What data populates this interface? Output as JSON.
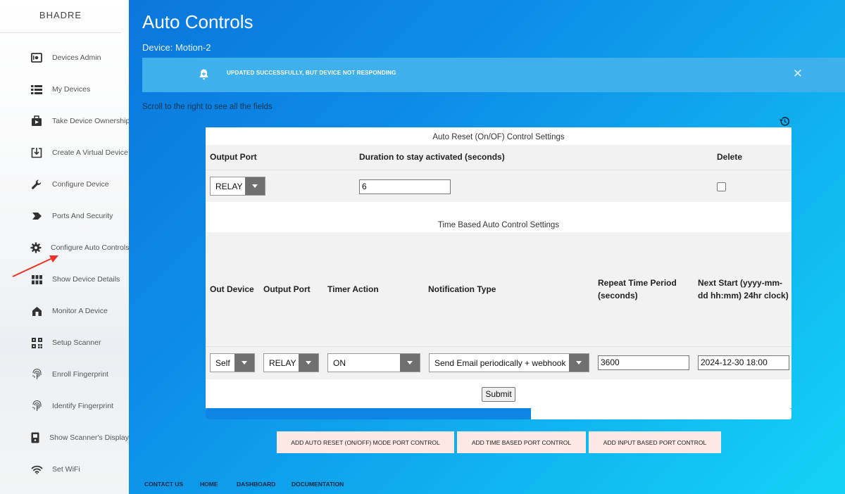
{
  "sidebar": {
    "brand": "BHADRE",
    "items": [
      {
        "label": "Devices Admin",
        "icon": "device-admin-icon"
      },
      {
        "label": "My Devices",
        "icon": "list-icon"
      },
      {
        "label": "Take Device Ownership",
        "icon": "ownership-icon"
      },
      {
        "label": "Create A Virtual Device",
        "icon": "download-box-icon"
      },
      {
        "label": "Configure Device",
        "icon": "wrench-icon"
      },
      {
        "label": "Ports And Security",
        "icon": "label-arrow-icon"
      },
      {
        "label": "Configure Auto Controls",
        "icon": "gear-icon"
      },
      {
        "label": "Show Device Details",
        "icon": "grid-icon"
      },
      {
        "label": "Monitor A Device",
        "icon": "home-icon"
      },
      {
        "label": "Setup Scanner",
        "icon": "qr-code-icon"
      },
      {
        "label": "Enroll Fingerprint",
        "icon": "fingerprint-icon"
      },
      {
        "label": "Identify Fingerprint",
        "icon": "fingerprint-icon"
      },
      {
        "label": "Show Scanner's Display",
        "icon": "scanner-display-icon"
      },
      {
        "label": "Set WiFi",
        "icon": "wifi-icon"
      }
    ]
  },
  "header": {
    "title": "Auto Controls",
    "device": "Device: Motion-2"
  },
  "alert": {
    "message": "UPDATED SUCCESSFULLY, BUT DEVICE NOT RESPONDING",
    "close": "✕"
  },
  "scroll_hint": "Scroll to the right to see all the fields",
  "auto_reset": {
    "title": "Auto Reset (On/OF) Control Settings",
    "headers": {
      "output_port": "Output Port",
      "duration": "Duration to stay activated (seconds)",
      "delete": "Delete"
    },
    "row": {
      "output_port": "RELAY",
      "duration": "6",
      "delete_checked": false
    }
  },
  "time_based": {
    "title": "Time Based Auto Control Settings",
    "headers": {
      "out_device": "Out Device",
      "output_port": "Output Port",
      "timer_action": "Timer Action",
      "notification_type": "Notification Type",
      "repeat_period": "Repeat Time Period (seconds)",
      "next_start": "Next Start (yyyy-mm-dd hh:mm) 24hr clock)"
    },
    "row": {
      "out_device": "Self",
      "output_port": "RELAY",
      "timer_action": "ON",
      "notification_type": "Send Email periodically + webhook",
      "repeat_period": "3600",
      "next_start": "2024-12-30 18:00"
    }
  },
  "submit_label": "Submit",
  "progress_fraction": 0.555,
  "add_buttons": {
    "auto_reset": "Add Auto Reset (On/Off) Mode Port Control",
    "time_based": "Add Time Based Port Control",
    "input_based": "Add Input Based Port Control"
  },
  "footer": {
    "contact": "CONTACT US",
    "home": "HOME",
    "dashboard": "DASHBOARD",
    "documentation": "DOCUMENTATION"
  },
  "colors": {
    "accent": "#0d86e6",
    "alert_bg": "#3fb0ec",
    "add_button_bg": "#fde8e6",
    "annotation_arrow": "#e8322a"
  }
}
